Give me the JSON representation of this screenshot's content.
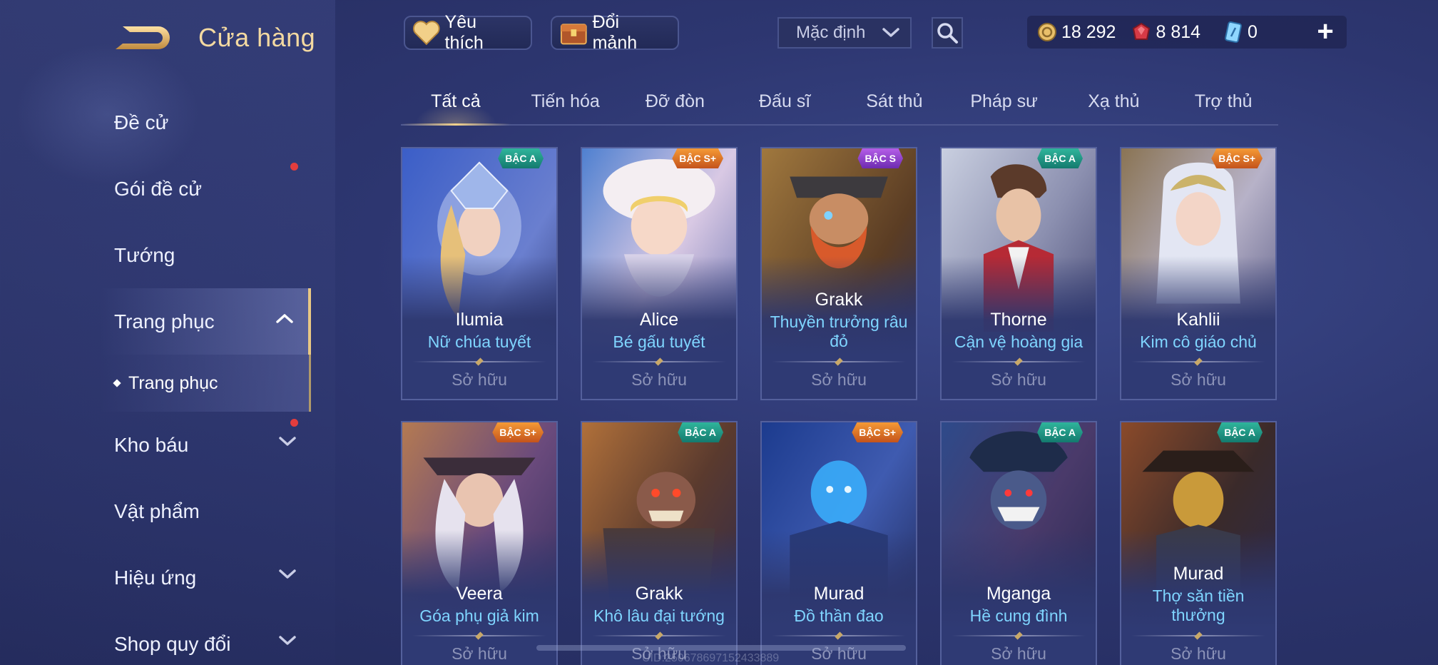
{
  "header": {
    "title": "Cửa hàng",
    "favorites_label": "Yêu thích",
    "shards_label": "Đổi mảnh",
    "sort_value": "Mặc định",
    "currency": {
      "gold": "18 292",
      "ruby": "8 814",
      "voucher": "0"
    },
    "plus_label": "+"
  },
  "sidebar": {
    "items": [
      {
        "label": "Đề cử"
      },
      {
        "label": "Gói đề cử"
      },
      {
        "label": "Tướng"
      },
      {
        "label": "Trang phục"
      },
      {
        "label": "Kho báu"
      },
      {
        "label": "Vật phẩm"
      },
      {
        "label": "Hiệu ứng"
      },
      {
        "label": "Shop quy đổi"
      }
    ],
    "sub_item": "Trang phục"
  },
  "tabs": [
    "Tất cả",
    "Tiến hóa",
    "Đỡ đòn",
    "Đấu sĩ",
    "Sát thủ",
    "Pháp sư",
    "Xạ thủ",
    "Trợ thủ"
  ],
  "cards": [
    {
      "hero": "Ilumia",
      "skin": "Nữ chúa tuyết",
      "badge": "BẬC A",
      "status": "Sở hữu"
    },
    {
      "hero": "Alice",
      "skin": "Bé gấu tuyết",
      "badge": "BẬC S+",
      "status": "Sở hữu"
    },
    {
      "hero": "Grakk",
      "skin": "Thuyền trưởng râu đỏ",
      "badge": "BẬC S",
      "status": "Sở hữu"
    },
    {
      "hero": "Thorne",
      "skin": "Cận vệ hoàng gia",
      "badge": "BẬC A",
      "status": "Sở hữu"
    },
    {
      "hero": "Kahlii",
      "skin": "Kim cô giáo chủ",
      "badge": "BẬC S+",
      "status": "Sở hữu"
    },
    {
      "hero": "Veera",
      "skin": "Góa phụ giả kim",
      "badge": "BẬC S+",
      "status": "Sở hữu"
    },
    {
      "hero": "Grakk",
      "skin": "Khô lâu đại tướng",
      "badge": "BẬC A",
      "status": "Sở hữu"
    },
    {
      "hero": "Murad",
      "skin": "Đồ thần đao",
      "badge": "BẬC S+",
      "status": "Sở hữu"
    },
    {
      "hero": "Mganga",
      "skin": "Hề cung đình",
      "badge": "BẬC A",
      "status": "Sở hữu"
    },
    {
      "hero": "Murad",
      "skin": "Thợ săn tiền thưởng",
      "badge": "BẬC A",
      "status": "Sở hữu"
    }
  ],
  "colors": {
    "accent_gold": "#f3d9a1",
    "skin_name": "#7fd5ff",
    "badge_a": "#2fb59c",
    "badge_s_plus": "#f59a35",
    "badge_s": "#b55ee8",
    "notification_dot": "#e33d3d"
  },
  "watermark": "UID:250678697152433889"
}
